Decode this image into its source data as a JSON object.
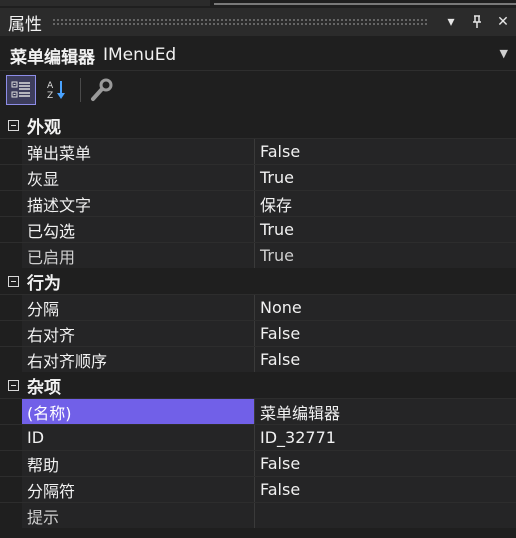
{
  "window": {
    "title": "属性"
  },
  "title_buttons": {
    "dropdown": "▾",
    "pin": "⊥",
    "close": "✕"
  },
  "object": {
    "name": "菜单编辑器",
    "type": "IMenuEd"
  },
  "toolbar": [
    {
      "icon": "categorized-icon",
      "active": true
    },
    {
      "icon": "alphabetical-sort-icon",
      "active": false
    },
    {
      "icon": "property-pages-wrench-icon",
      "active": false
    }
  ],
  "categories": [
    {
      "label": "外观",
      "rows": [
        {
          "name": "弹出菜单",
          "value": "False"
        },
        {
          "name": "灰显",
          "value": "True"
        },
        {
          "name": "描述文字",
          "value": "保存"
        },
        {
          "name": "已勾选",
          "value": "True"
        },
        {
          "name": "已启用",
          "value": "True"
        }
      ]
    },
    {
      "label": "行为",
      "rows": [
        {
          "name": "分隔",
          "value": "None"
        },
        {
          "name": "右对齐",
          "value": "False"
        },
        {
          "name": "右对齐顺序",
          "value": "False"
        }
      ]
    },
    {
      "label": "杂项",
      "rows": [
        {
          "name": "(名称)",
          "value": "菜单编辑器"
        },
        {
          "name": "ID",
          "value": "ID_32771"
        },
        {
          "name": "帮助",
          "value": "False"
        },
        {
          "name": "分隔符",
          "value": "False"
        },
        {
          "name": "提示",
          "value": ""
        }
      ]
    }
  ],
  "colors": {
    "selection": "#7160e8",
    "background": "#1f1f1f",
    "row": "#252526"
  }
}
